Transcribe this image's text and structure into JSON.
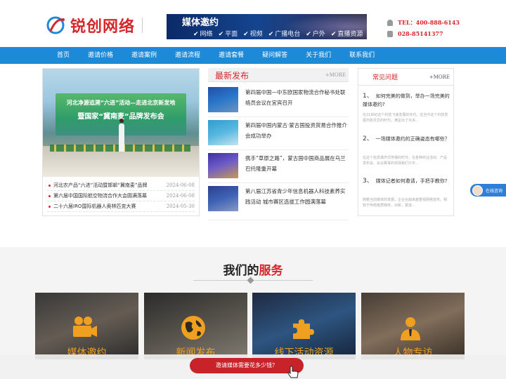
{
  "header": {
    "logo_text": "锐创网络",
    "banner": {
      "title": "媒体邀约",
      "tags": [
        "网络",
        "平面",
        "视频",
        "广播电台",
        "户外",
        "直播资源"
      ]
    },
    "contact": {
      "tel": "TEL：400-888-6143",
      "phone": "028-85141377"
    }
  },
  "nav": {
    "items": [
      "首页",
      "邀请价格",
      "邀请案例",
      "邀请流程",
      "邀请套餐",
      "疑问解答",
      "关于我们",
      "联系我们"
    ]
  },
  "hero": {
    "image": {
      "screen_line1": "河北净源追溯“六进”活动—走进北京新发地",
      "screen_line2": "暨国家“冀南麦”品牌发布会"
    },
    "list": [
      {
        "title": "河北农产品“六进”活动暨邯郸“冀南麦”品牌",
        "date": "2024-06-08"
      },
      {
        "title": "第六届中国国际航空物流合作大会圆满落幕",
        "date": "2024-06-08"
      },
      {
        "title": "二十六届IRO国际机器人奥林匹克大赛",
        "date": "2024-05-30"
      }
    ]
  },
  "latest": {
    "title": "最新发布",
    "more": "+MORE",
    "items": [
      {
        "title": "第四届中国—中东欧国家物流合作秘书处联络员会议在宜宾召开"
      },
      {
        "title": "第四届中国内蒙古·蒙古国投资贸易合作推介会成功举办"
      },
      {
        "title": "携手“草原之路”，蒙古国中国商品展在乌兰巴托隆重开幕"
      },
      {
        "title": "第八届江苏省青少年信息机器人科技素养实践活动 城市赛区选拔工作圆满落幕"
      }
    ]
  },
  "faq": {
    "title": "常见问题",
    "more": "+MORE",
    "items": [
      {
        "num": "1、",
        "q": "如何完美的做到，举办一场完美的媒体邀约?",
        "a": "在21世纪这个科技飞速发展的年代，在当今这个科技发展日新月异的时代，满足出了许多..."
      },
      {
        "num": "2、",
        "q": "一场媒体邀约的正确姿态有哪些？",
        "a": "在这个信息爆炸式传播的时代，在各种商业活动、产品发布会、会议赛事的现场我们只乎..."
      },
      {
        "num": "3、",
        "q": "媒体记者如何邀请，手把手教你?",
        "a": "随着当前媒体的发展，企业合越来越重视网络宣传。相较于传统纸质媒体，出新，报道..."
      }
    ]
  },
  "consult": {
    "label": "在线咨询"
  },
  "services": {
    "title_prefix": "我们的",
    "title_highlight": "服务",
    "cards": [
      {
        "name": "媒体邀约",
        "icon": "camera-icon"
      },
      {
        "name": "新闻发布",
        "icon": "globe-icon"
      },
      {
        "name": "线下活动资源",
        "icon": "puzzle-icon"
      },
      {
        "name": "人物专访",
        "icon": "person-icon"
      }
    ]
  },
  "cta": {
    "label": "邀请媒体需要花多少钱？"
  }
}
